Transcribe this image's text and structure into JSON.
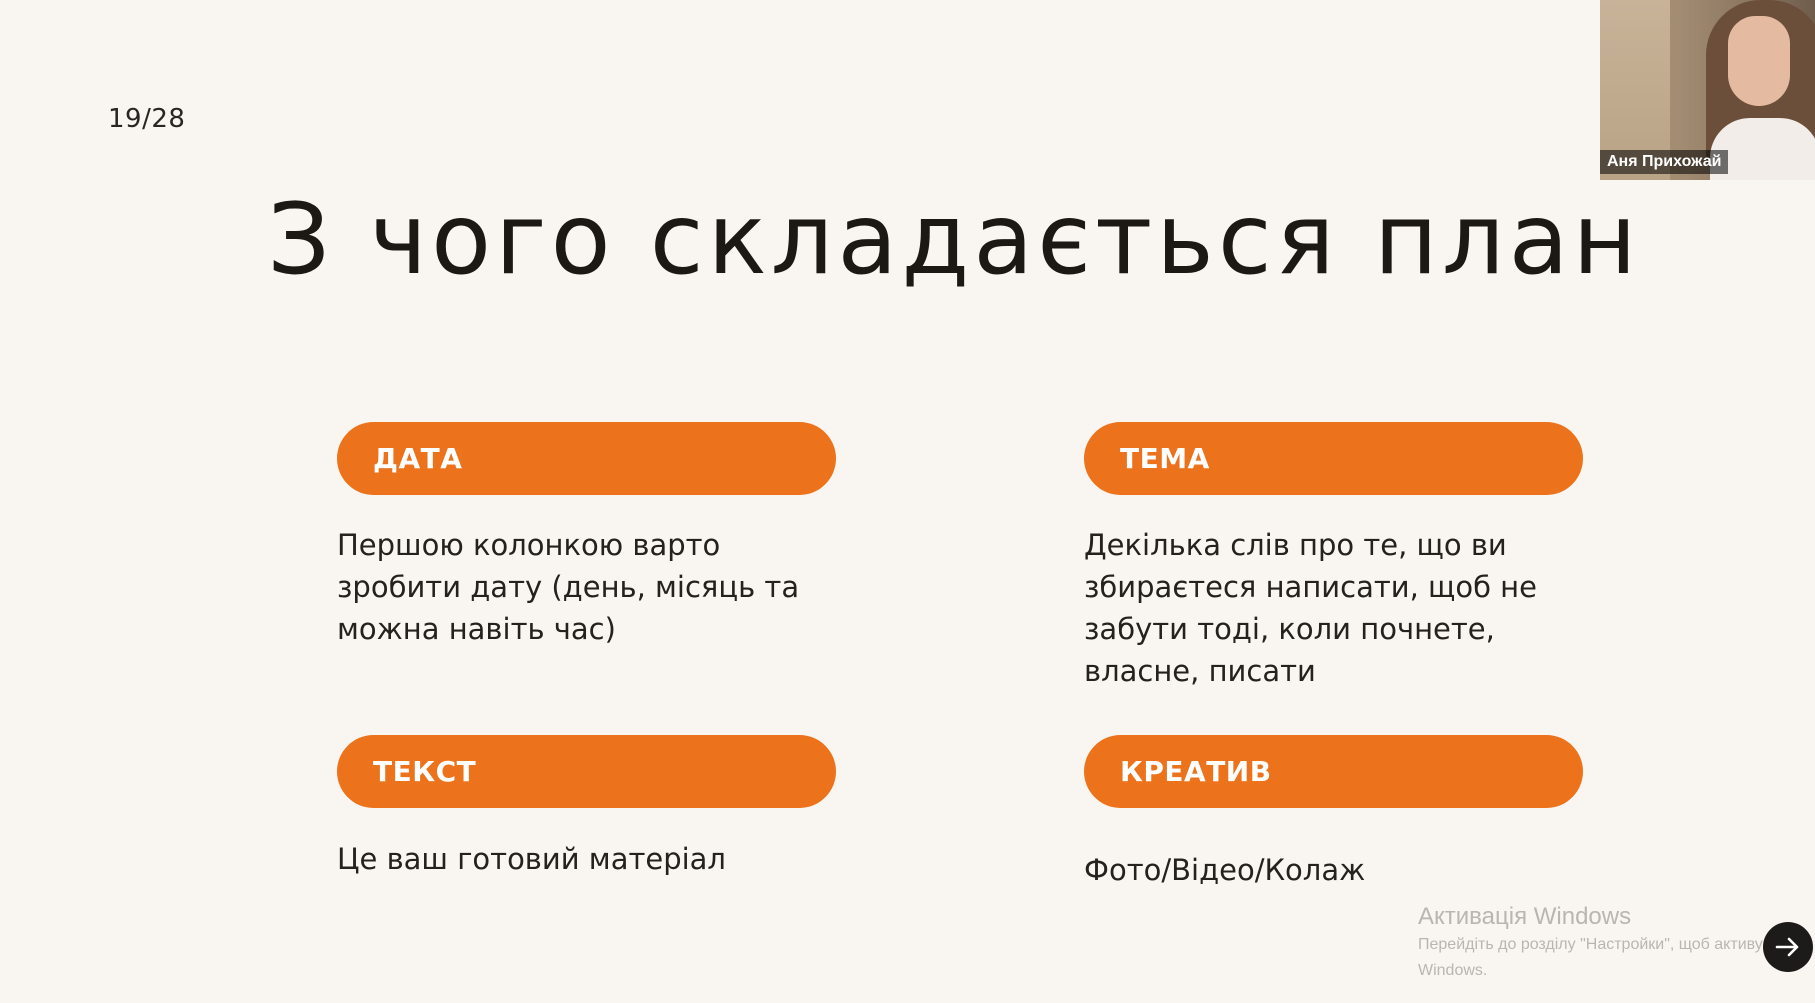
{
  "slide": {
    "counter": "19/28",
    "title": "З чого складається план"
  },
  "blocks": [
    {
      "label": "ДАТА",
      "description": "Першою колонкою варто зробити дату (день, місяць та можна навіть час)"
    },
    {
      "label": "ТЕМА",
      "description": "Декілька слів про те, що ви збираєтеся написати, щоб не забути тоді, коли почнете, власне, писати"
    },
    {
      "label": "ТЕКСТ",
      "description": "Це ваш готовий матеріал"
    },
    {
      "label": "КРЕАТИВ",
      "description": "Фото/Відео/Колаж"
    }
  ],
  "webcam": {
    "participant_name": "Аня Прихожай"
  },
  "watermark": {
    "title": "Активація Windows",
    "subtitle_line1": "Перейдіть до розділу \"Настройки\", щоб активувати",
    "subtitle_line2": "Windows."
  },
  "controls": {
    "next_icon": "arrow-right-icon"
  },
  "colors": {
    "accent": "#ec731b",
    "background": "#f9f6f2",
    "text": "#1f1a17"
  }
}
